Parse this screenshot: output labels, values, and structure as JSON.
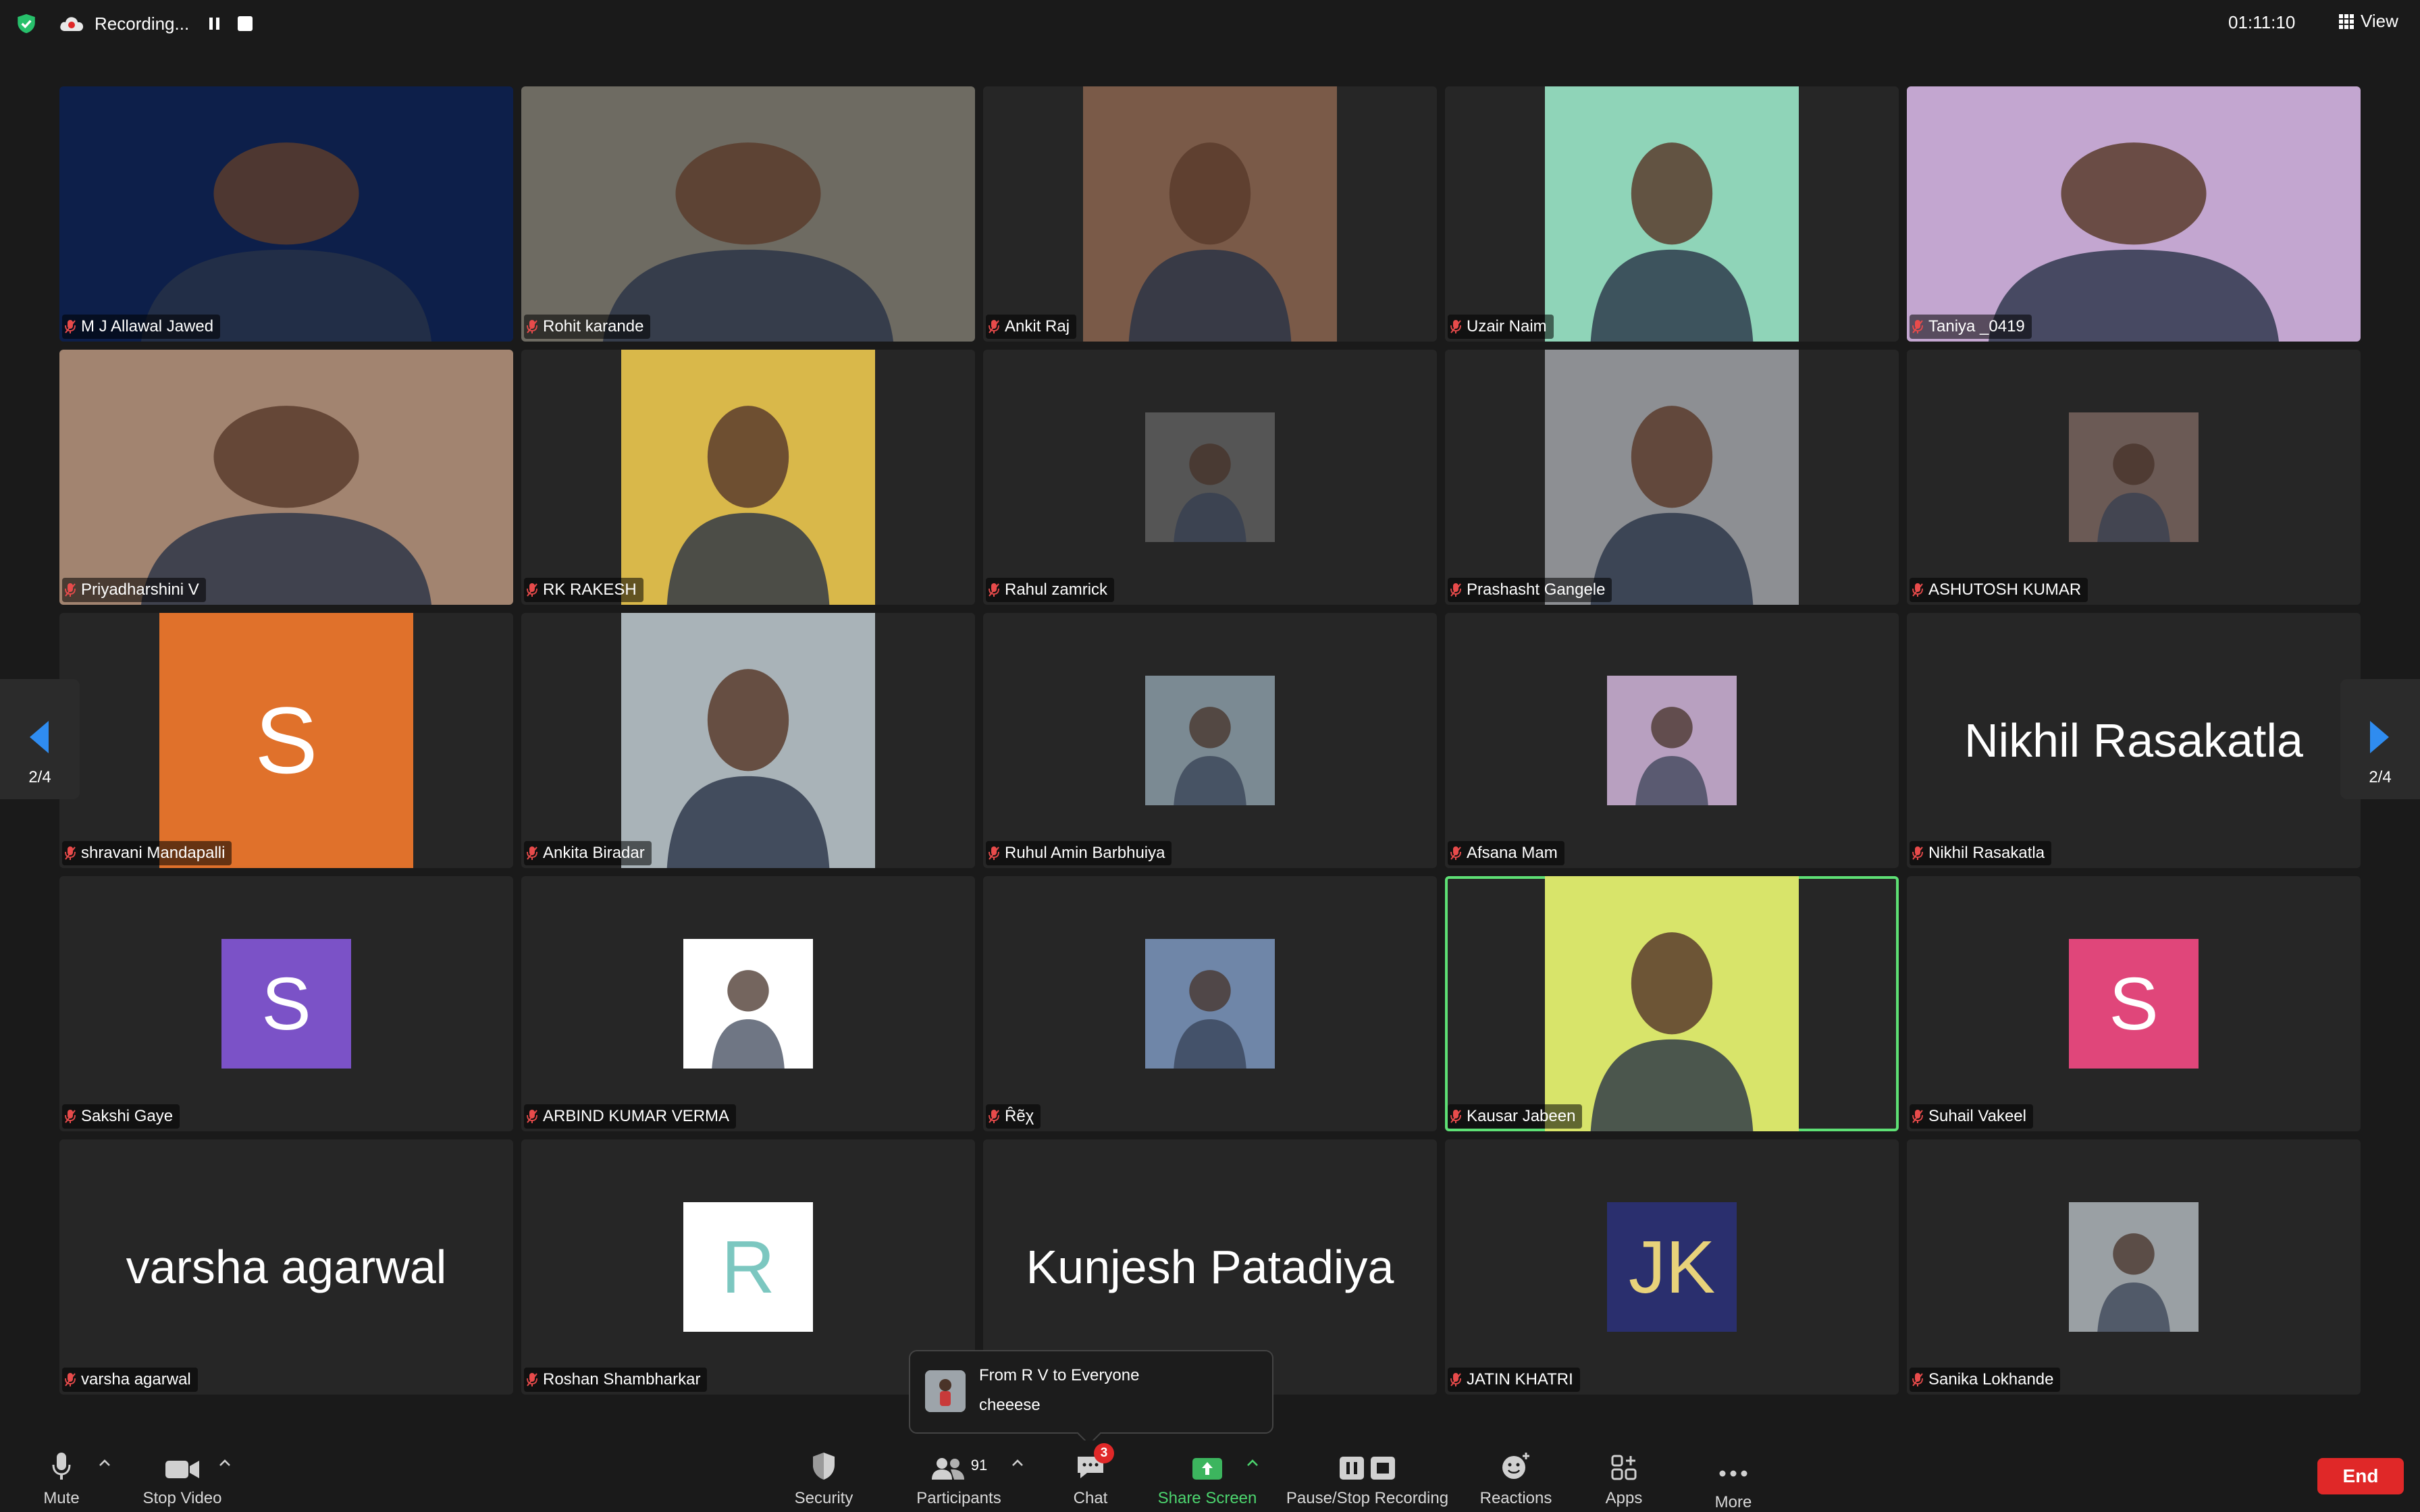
{
  "topbar": {
    "recording_label": "Recording...",
    "clock": "01:11:10",
    "view_label": "View"
  },
  "participants": [
    {
      "name": "M J Allawal Jawed",
      "kind": "video",
      "bg": "#0d1f4a"
    },
    {
      "name": "Rohit karande",
      "kind": "video",
      "bg": "#6e6b62"
    },
    {
      "name": "Ankit Raj",
      "kind": "video",
      "bg": "#7a5a48"
    },
    {
      "name": "Uzair Naim",
      "kind": "video",
      "bg": "#8fd4b8"
    },
    {
      "name": "Taniya _0419",
      "kind": "video",
      "bg": "#c3a6d0"
    },
    {
      "name": "Priyadharshini V",
      "kind": "video",
      "bg": "#a28470"
    },
    {
      "name": "RK RAKESH",
      "kind": "video",
      "bg": "#d9b84a"
    },
    {
      "name": "Rahul zamrick",
      "kind": "photo",
      "bg": "#555555"
    },
    {
      "name": "Prashasht Gangele",
      "kind": "video",
      "bg": "#8d8f93"
    },
    {
      "name": "ASHUTOSH KUMAR",
      "kind": "photo",
      "bg": "#6b5a55"
    },
    {
      "name": "shravani Mandapalli",
      "kind": "video-letter",
      "letter": "S",
      "bg": "#e0712b"
    },
    {
      "name": "Ankita Biradar",
      "kind": "video",
      "bg": "#a9b3b8"
    },
    {
      "name": "Ruhul Amin Barbhuiya",
      "kind": "photo",
      "bg": "#7b8a93"
    },
    {
      "name": "Afsana Mam",
      "kind": "photo",
      "bg": "#b8a0c0"
    },
    {
      "name": "Nikhil Rasakatla",
      "kind": "text",
      "display": "Nikhil Rasakatla"
    },
    {
      "name": "Sakshi Gaye",
      "kind": "letter",
      "letter": "S",
      "bg": "#7b52c7"
    },
    {
      "name": "ARBIND KUMAR VERMA",
      "kind": "photo",
      "bg": "#ffffff"
    },
    {
      "name": "Ȓẽχ",
      "kind": "photo",
      "bg": "#6f86a8"
    },
    {
      "name": "Kausar Jabeen",
      "kind": "video",
      "bg": "#d8e46a",
      "active": true
    },
    {
      "name": "Suhail Vakeel",
      "kind": "letter",
      "letter": "S",
      "bg": "#e0467a"
    },
    {
      "name": "varsha agarwal",
      "kind": "text",
      "display": "varsha agarwal"
    },
    {
      "name": "Roshan Shambharkar",
      "kind": "letter",
      "letter": "R",
      "bg": "#ffffff",
      "fg": "#7cc7c0"
    },
    {
      "name": "Kunjesh Patadiya",
      "kind": "text",
      "display": "Kunjesh Patadiya",
      "hide_label": true
    },
    {
      "name": "JATIN KHATRI",
      "kind": "letter",
      "letter": "JK",
      "bg": "#2a2f6e",
      "fg": "#e8d27a"
    },
    {
      "name": "Sanika Lokhande",
      "kind": "photo",
      "bg": "#9aa0a4"
    }
  ],
  "pager": {
    "left": "2/4",
    "right": "2/4"
  },
  "chat_toast": {
    "from": "From R V to Everyone",
    "message": "cheeese"
  },
  "toolbar": {
    "mute": "Mute",
    "stop_video": "Stop Video",
    "security": "Security",
    "participants": "Participants",
    "participant_count": "91",
    "chat": "Chat",
    "chat_badge": "3",
    "share_screen": "Share Screen",
    "pause_stop_recording": "Pause/Stop Recording",
    "reactions": "Reactions",
    "apps": "Apps",
    "more": "More",
    "end": "End"
  },
  "colors": {
    "accent_green": "#5ee075",
    "share_green": "#3cb55e",
    "end_red": "#e02828",
    "pager_blue": "#2f8cf0"
  }
}
